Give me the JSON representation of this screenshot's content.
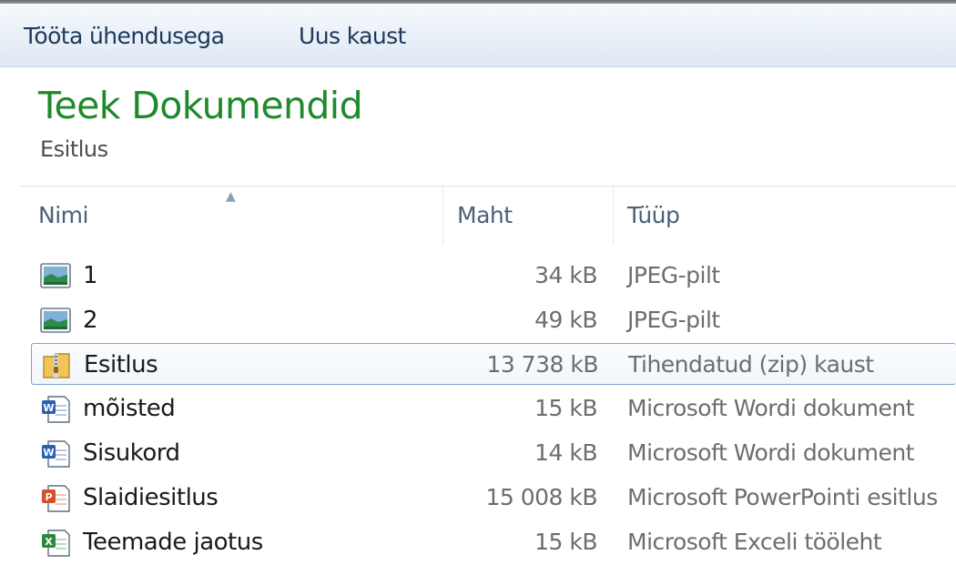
{
  "toolbar": {
    "work_online_label": "Tööta ühendusega",
    "new_folder_label": "Uus kaust"
  },
  "library": {
    "title": "Teek Dokumendid",
    "subtitle": "Esitlus"
  },
  "columns": {
    "name": "Nimi",
    "size": "Maht",
    "type": "Tüüp",
    "sorted_by": "name",
    "sort_direction": "ascending"
  },
  "files": [
    {
      "name": "1",
      "size": "34 kB",
      "type": "JPEG-pilt",
      "icon": "jpeg-image-icon",
      "selected": false
    },
    {
      "name": "2",
      "size": "49 kB",
      "type": "JPEG-pilt",
      "icon": "jpeg-image-icon",
      "selected": false
    },
    {
      "name": "Esitlus",
      "size": "13 738 kB",
      "type": "Tihendatud (zip) kaust",
      "icon": "zip-folder-icon",
      "selected": true
    },
    {
      "name": "mõisted",
      "size": "15 kB",
      "type": "Microsoft Wordi dokument",
      "icon": "word-document-icon",
      "selected": false
    },
    {
      "name": "Sisukord",
      "size": "14 kB",
      "type": "Microsoft Wordi dokument",
      "icon": "word-document-icon",
      "selected": false
    },
    {
      "name": "Slaidiesitlus",
      "size": "15 008 kB",
      "type": "Microsoft PowerPointi esitlus",
      "icon": "powerpoint-document-icon",
      "selected": false
    },
    {
      "name": "Teemade jaotus",
      "size": "15 kB",
      "type": "Microsoft Exceli tööleht",
      "icon": "excel-worksheet-icon",
      "selected": false
    }
  ],
  "colors": {
    "library_title": "#1e8a2b",
    "selection_border": "#7da2ce",
    "toolbar_text": "#1e395b"
  }
}
